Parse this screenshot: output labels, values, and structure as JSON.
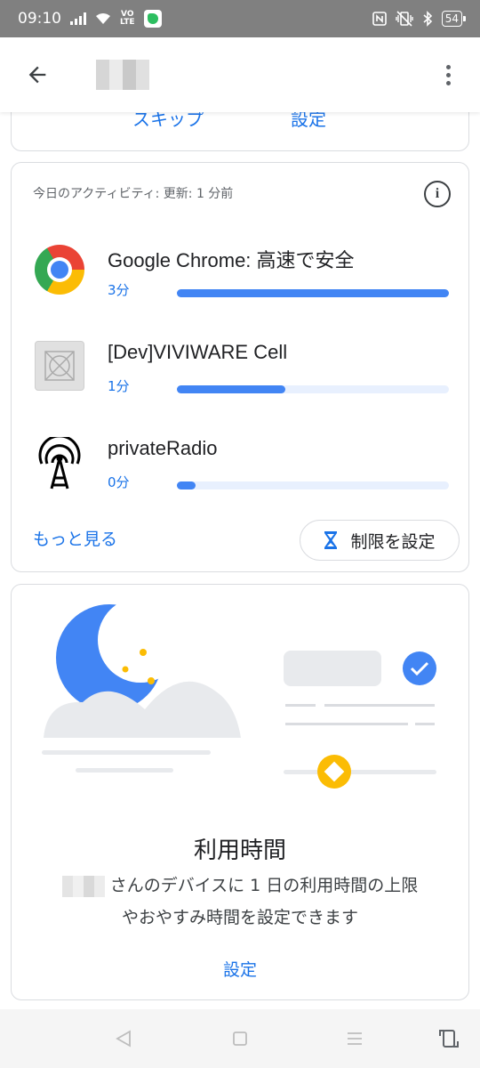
{
  "status_bar": {
    "time": "09:10",
    "volte_line1": "VO",
    "volte_line2": "LTE",
    "battery": "54",
    "icons": [
      "signal-icon",
      "wifi-icon",
      "volte-icon",
      "evernote-icon",
      "nfc-icon",
      "vibrate-icon",
      "bluetooth-icon",
      "battery-icon"
    ]
  },
  "app_bar": {
    "back_icon": "arrow-back-icon",
    "more_icon": "more-vert-icon"
  },
  "top_card": {
    "skip_label": "スキップ",
    "settings_label": "設定"
  },
  "activity": {
    "header": "今日のアクティビティ: 更新: 1 分前",
    "info_icon": "i",
    "apps": [
      {
        "name": "Google Chrome: 高速で安全",
        "time": "3分",
        "progress": 1.0,
        "icon": "chrome-icon"
      },
      {
        "name": "[Dev]VIVIWARE Cell",
        "time": "1分",
        "progress": 0.4,
        "icon": "viviware-cell-icon"
      },
      {
        "name": "privateRadio",
        "time": "0分",
        "progress": 0.07,
        "icon": "radio-tower-icon"
      }
    ],
    "more_label": "もっと見る",
    "limit_label": "制限を設定"
  },
  "usage": {
    "title": "利用時間",
    "desc_line1": "さんのデバイスに 1 日の利用時間の上限",
    "desc_line2": "やおやすみ時間を設定できます",
    "setting_label": "設定"
  },
  "colors": {
    "accent": "#1a73e8",
    "progress_fill": "#4285f4",
    "progress_track": "#e8f0fe",
    "status_bar": "#808080",
    "moon": "#4285f4",
    "star": "#fbbc04"
  }
}
